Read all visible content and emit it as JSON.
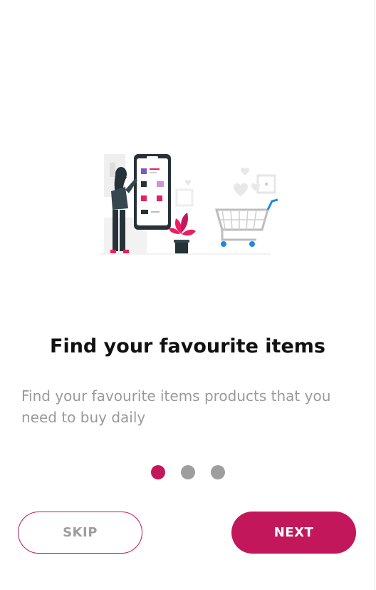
{
  "onboarding": {
    "title": "Find your favourite items",
    "description": "Find your favourite items products that you need to buy daily",
    "page_indicator": {
      "current": 1,
      "total": 3
    },
    "skip_label": "SKIP",
    "next_label": "NEXT",
    "illustration": "woman-shopping-on-phone-with-cart-illustration"
  },
  "colors": {
    "accent": "#c2185b",
    "inactive_dot": "#9e9e9e",
    "description_text": "#9a9a9a",
    "title_text": "#111111"
  }
}
